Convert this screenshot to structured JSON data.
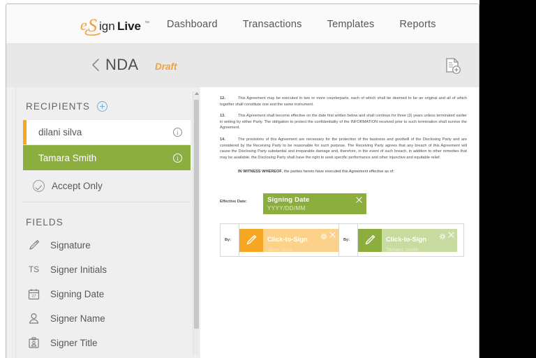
{
  "brand": {
    "logo_text_1": "e",
    "logo_text_2": "Sign",
    "logo_text_3": "Live",
    "logo_tm": "™",
    "orange": "#F0A13C",
    "green": "#8CAE3E",
    "blue": "#6AAEDE"
  },
  "topnav": {
    "items": [
      {
        "label": "Dashboard",
        "name": "nav-dashboard"
      },
      {
        "label": "Transactions",
        "name": "nav-transactions"
      },
      {
        "label": "Templates",
        "name": "nav-templates"
      },
      {
        "label": "Reports",
        "name": "nav-reports"
      }
    ]
  },
  "subheader": {
    "back_icon": "chevron-left-icon",
    "title": "NDA",
    "status": "Draft",
    "action_icon": "document-add-icon"
  },
  "sidebar": {
    "recipients_title": "RECIPIENTS",
    "add_recipient_icon": "plus-circle-icon",
    "recipients": [
      {
        "name": "dilani silva",
        "selected": false,
        "accent": "#F6A723",
        "info_icon": "info-icon"
      },
      {
        "name": "Tamara Smith",
        "selected": true,
        "accent": "#8CAE3E",
        "info_icon": "info-icon"
      }
    ],
    "accept_only": {
      "label": "Accept Only",
      "icon": "check-circle-icon"
    },
    "fields_title": "FIELDS",
    "fields": [
      {
        "label": "Signature",
        "icon": "pen-icon"
      },
      {
        "label": "Signer Initials",
        "icon": "ts-text-icon",
        "glyph": "TS"
      },
      {
        "label": "Signing Date",
        "icon": "calendar-icon"
      },
      {
        "label": "Signer Name",
        "icon": "person-icon"
      },
      {
        "label": "Signer Title",
        "icon": "id-badge-icon"
      }
    ]
  },
  "document": {
    "paragraphs": [
      {
        "number": "12.",
        "text": "This Agreement may be executed in two or more counterparts, each of which shall be deemed to be an original and all of which together shall constitute one and the same instrument."
      },
      {
        "number": "13.",
        "text": "This Agreement shall become effective on the date first written below and shall continue for three (3) years unless terminated earlier in writing by either Party. The obligation to protect the confidentiality of the INFORMATION received prior to such termination shall survive the Agreement."
      },
      {
        "number": "14.",
        "text": "The provisions of this Agreement are necessary for the protection of the business and goodwill of the Disclosing Party and are considered by the Receiving Party to be reasonable for such purpose. The Receiving Party agrees that any breach of this Agreement will cause the Disclosing Party substantial and irreparable damage and, therefore, in the event of such breach, in addition to other remedies that may be available, the Disclosing Party shall have the right to seek specific performance and other injunctive and equitable relief."
      }
    ],
    "witness_bold": "IN WITNESS WHEREOF",
    "witness_rest": ", the parties hereto have executed this Agreement effective as of:",
    "effective_date_label": "Effective Date:",
    "date_field": {
      "title": "Signing Date",
      "placeholder": "YYYY/DD/MM",
      "close_icon": "close-icon",
      "color": "#8CAE3E"
    },
    "signature_cells": [
      {
        "by_label": "By:",
        "title": "Click-to-Sign",
        "signer": "dilani silva",
        "color": "#F5A623",
        "fill": "#FCD28A",
        "pen_icon": "pen-icon",
        "gear_icon": "gear-icon",
        "close_icon": "close-icon"
      },
      {
        "by_label": "By:",
        "title": "Click-to-Sign",
        "signer": "Tamara Smith",
        "color": "#8CAE3E",
        "fill": "#C8DBA0",
        "pen_icon": "pen-icon",
        "gear_icon": "gear-icon",
        "close_icon": "close-icon"
      }
    ]
  },
  "scrollbar": {
    "name": "sidebar-scrollbar"
  }
}
